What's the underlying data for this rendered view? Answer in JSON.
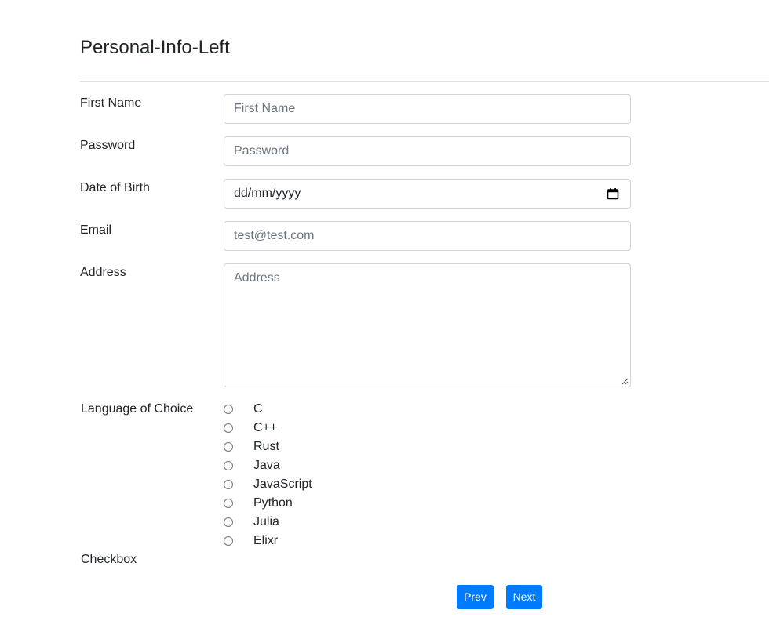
{
  "page": {
    "title": "Personal-Info-Left"
  },
  "form": {
    "first_name": {
      "label": "First Name",
      "placeholder": "First Name",
      "value": ""
    },
    "password": {
      "label": "Password",
      "placeholder": "Password",
      "value": ""
    },
    "dob": {
      "label": "Date of Birth",
      "display": "dd/mm/yyyy"
    },
    "email": {
      "label": "Email",
      "placeholder": "test@test.com",
      "value": ""
    },
    "address": {
      "label": "Address",
      "placeholder": "Address",
      "value": ""
    },
    "language": {
      "label": "Language of Choice",
      "options": [
        "C",
        "C++",
        "Rust",
        "Java",
        "JavaScript",
        "Python",
        "Julia",
        "Elixr"
      ],
      "selected": null
    },
    "checkbox": {
      "label": "Checkbox"
    }
  },
  "actions": {
    "prev_label": "Prev",
    "next_label": "Next"
  },
  "colors": {
    "primary": "#007bff",
    "input_border": "#ced4da",
    "divider": "#dee2e6",
    "text": "#212529",
    "placeholder": "#6c757d"
  },
  "icons": {
    "date_picker": "calendar-icon"
  }
}
